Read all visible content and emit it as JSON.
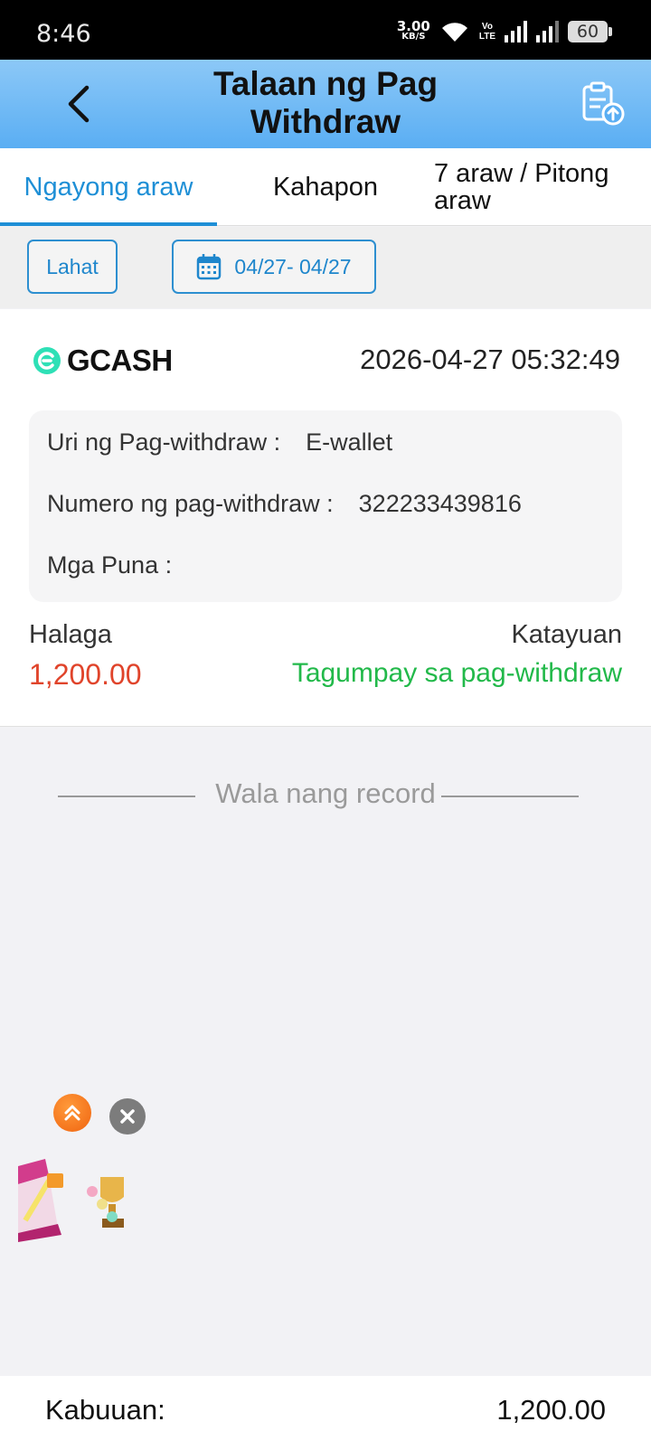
{
  "status_bar": {
    "time": "8:46",
    "net_speed_value": "3.00",
    "net_speed_unit": "KB/S",
    "volte_top": "Vo",
    "volte_bottom": "LTE",
    "battery": "60"
  },
  "header": {
    "title_line1": "Talaan ng Pag",
    "title_line2": "Withdraw",
    "back_icon": "chevron-left-icon",
    "action_icon": "clipboard-upload-icon"
  },
  "tabs": [
    {
      "label": "Ngayong araw",
      "active": true
    },
    {
      "label": "Kahapon",
      "active": false
    },
    {
      "label_line1": "7 araw / Pitong",
      "label_line2": "araw",
      "active": false
    }
  ],
  "filters": {
    "type_label": "Lahat",
    "date_range": "04/27- 04/27",
    "date_icon": "calendar-icon"
  },
  "record": {
    "method": "GCASH",
    "datetime": "2026-04-27 05:32:49",
    "type_label": "Uri ng Pag-withdraw :",
    "type_value": "E-wallet",
    "number_label": "Numero ng pag-withdraw :",
    "number_value": "322233439816",
    "remarks_label": "Mga Puna :",
    "remarks_value": "",
    "amount_label": "Halaga",
    "amount_value": "1,200.00",
    "status_label": "Katayuan",
    "status_value": "Tagumpay sa pag-withdraw"
  },
  "no_more_text": "Wala nang record",
  "footer": {
    "total_label": "Kabuuan:",
    "total_value": "1,200.00"
  },
  "colors": {
    "accent": "#1e8fd6",
    "amount": "#e0442b",
    "success": "#22b94a",
    "header_gradient_top": "#8cc8f7",
    "header_gradient_bottom": "#5aaef3"
  }
}
